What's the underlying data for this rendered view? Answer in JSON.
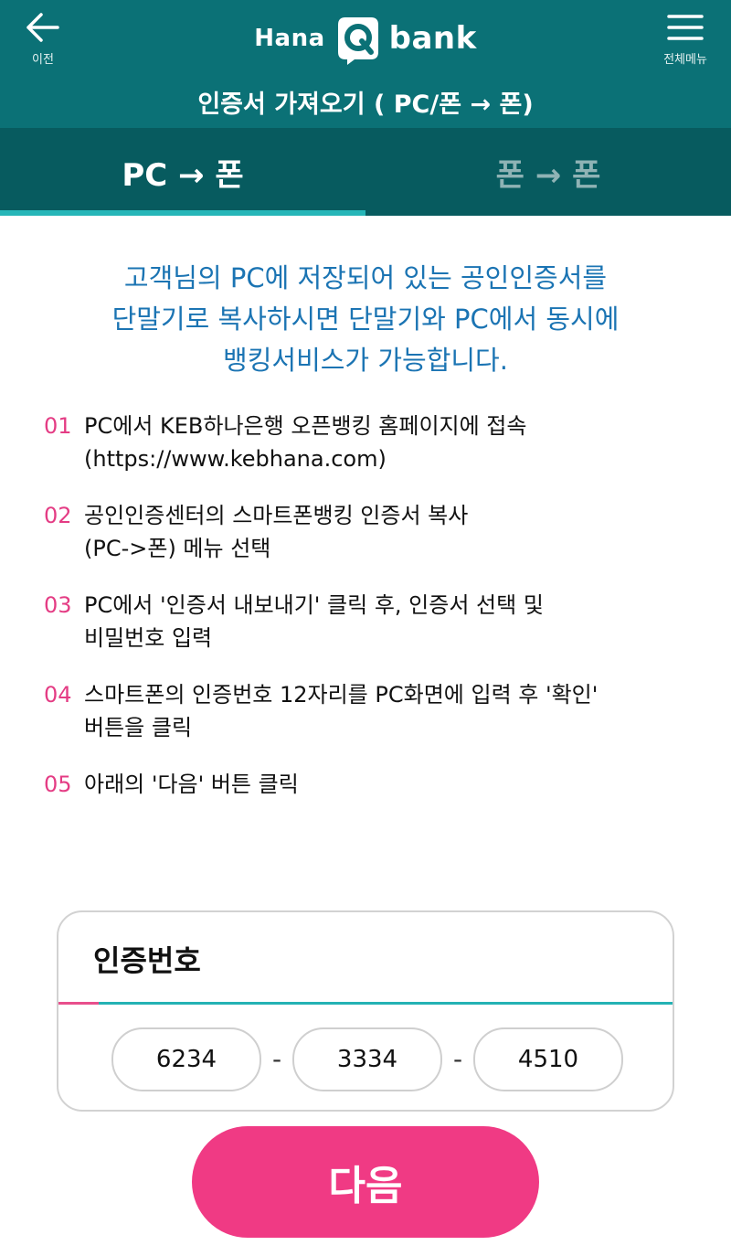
{
  "header": {
    "back_label": "이전",
    "menu_label": "전체메뉴",
    "logo_text_left": "Hana",
    "logo_text_right": "bank",
    "title": "인증서 가져오기 ( PC/폰 → 폰)"
  },
  "tabs": [
    {
      "label": "PC → 폰",
      "active": true
    },
    {
      "label": "폰 → 폰",
      "active": false
    }
  ],
  "intro": {
    "lines": [
      "고객님의 PC에 저장되어 있는 공인인증서를",
      "단말기로 복사하시면 단말기와 PC에서 동시에",
      "뱅킹서비스가 가능합니다."
    ]
  },
  "steps": [
    {
      "num": "01",
      "lines": [
        "PC에서 KEB하나은행 오픈뱅킹 홈페이지에 접속",
        "(https://www.kebhana.com)"
      ]
    },
    {
      "num": "02",
      "lines": [
        "공인인증센터의 스마트폰뱅킹 인증서 복사",
        "(PC->폰) 메뉴 선택"
      ]
    },
    {
      "num": "03",
      "lines": [
        "PC에서 '인증서 내보내기' 클릭 후, 인증서 선택 및",
        "비밀번호 입력"
      ]
    },
    {
      "num": "04",
      "lines": [
        "스마트폰의 인증번호 12자리를 PC화면에 입력 후 '확인'",
        "버튼을 클릭"
      ]
    },
    {
      "num": "05",
      "lines": [
        "아래의 '다음' 버튼 클릭"
      ]
    }
  ],
  "auth": {
    "title": "인증번호",
    "codes": [
      "6234",
      "3334",
      "4510"
    ],
    "separator": "-"
  },
  "next_label": "다음",
  "colors": {
    "header_bg": "#0b7176",
    "tab_bg": "#075b5f",
    "tab_indicator": "#26b6b8",
    "intro_text": "#1b74b3",
    "step_num": "#e43c84",
    "next_button": "#f03a84"
  }
}
